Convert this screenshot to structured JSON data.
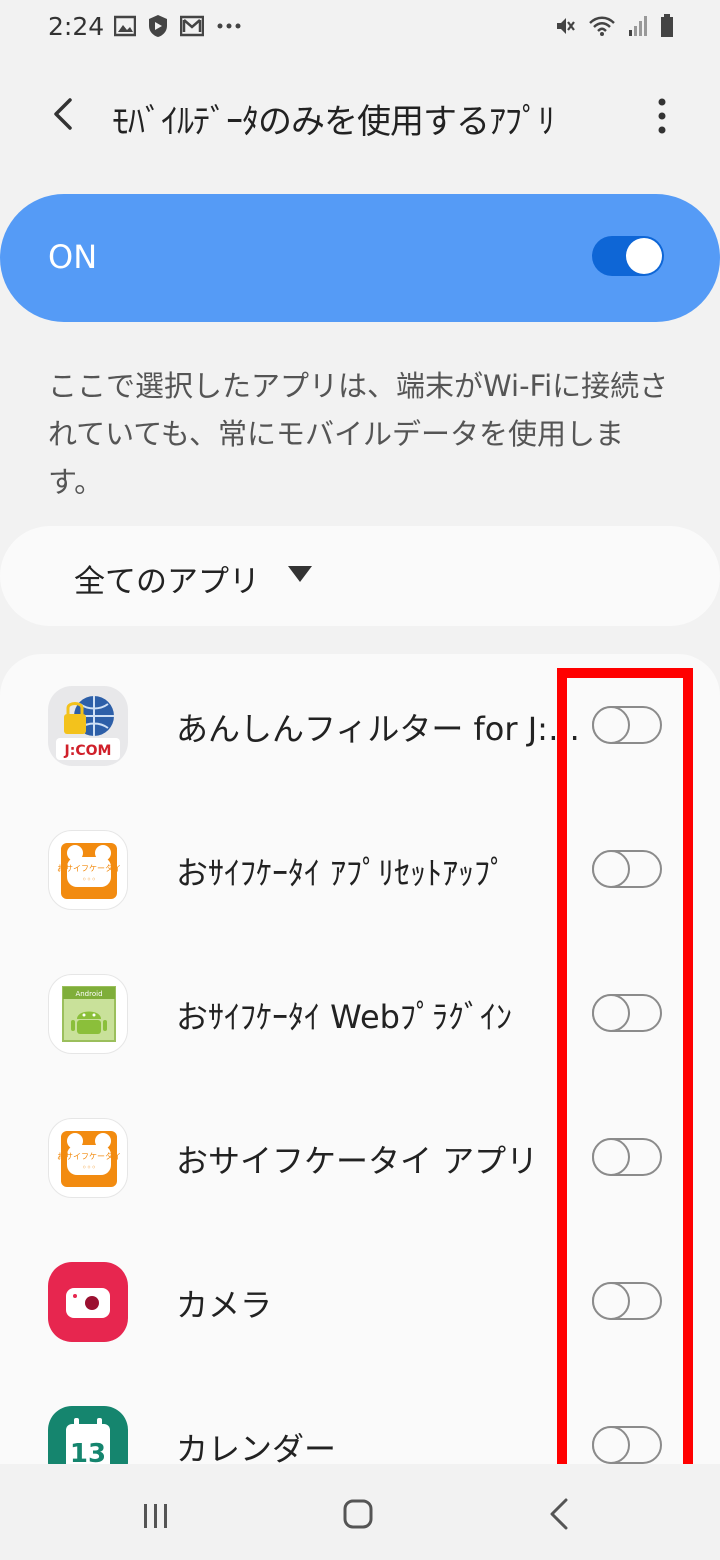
{
  "status_bar": {
    "time": "2:24",
    "left_icons": [
      "image-icon",
      "shield-icon",
      "gmail-icon",
      "more-dots-icon"
    ],
    "right_icons": [
      "mute-icon",
      "wifi-icon",
      "signal-icon",
      "battery-icon"
    ]
  },
  "header": {
    "title": "ﾓﾊﾞｲﾙﾃﾞｰﾀのみを使用するｱﾌﾟﾘ"
  },
  "master_toggle": {
    "label": "ON",
    "state": true,
    "color": "#559bf6"
  },
  "description": "ここで選択したアプリは、端末がWi-Fiに接続されていても、常にモバイルデータを使用します。",
  "filter": {
    "selected": "全てのアプリ"
  },
  "apps": [
    {
      "label": "あんしんフィルター for J:COM",
      "icon": "jcom-filter-icon",
      "enabled": false
    },
    {
      "label": "おｻｲﾌｹｰﾀｲ ｱﾌﾟﾘｾｯﾄｱｯﾌﾟ",
      "icon": "osaifu-keitai-icon",
      "enabled": false
    },
    {
      "label": "おｻｲﾌｹｰﾀｲ Webﾌﾟﾗｸﾞｲﾝ",
      "icon": "android-plugin-icon",
      "enabled": false
    },
    {
      "label": "おサイフケータイ アプリ",
      "icon": "osaifu-keitai-icon",
      "enabled": false
    },
    {
      "label": "カメラ",
      "icon": "camera-icon",
      "enabled": false
    },
    {
      "label": "カレンダー",
      "icon": "calendar-icon",
      "enabled": false
    }
  ],
  "calendar_icon_day": "13",
  "jcom_icon_text": "J:COM",
  "osaifu_icon_text": "おサイフケータイ",
  "android_icon_text": "Android",
  "highlight_color": "#ff0000"
}
